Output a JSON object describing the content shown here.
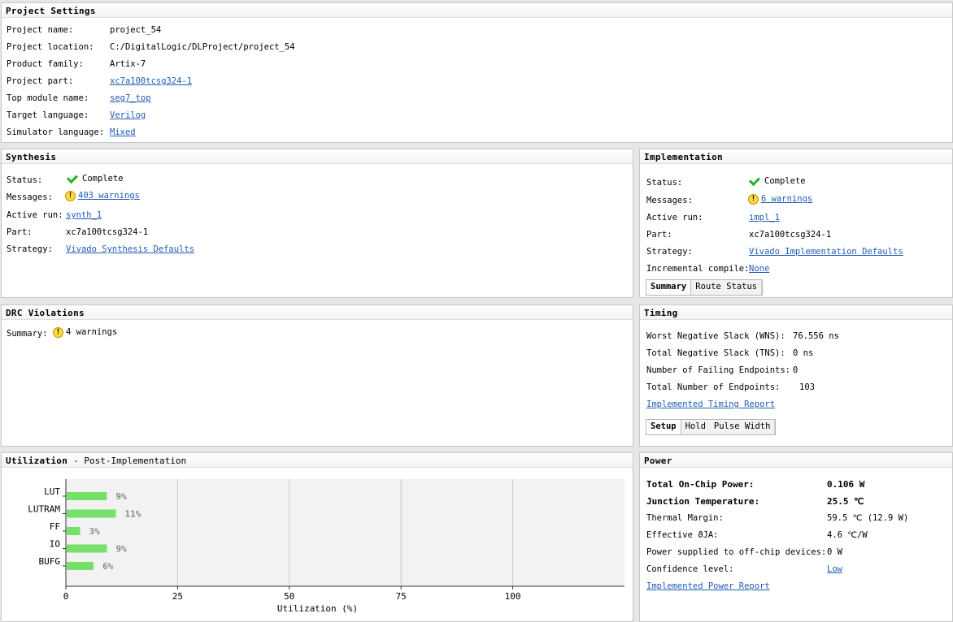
{
  "project_settings": {
    "title": "Project Settings",
    "rows": [
      {
        "label": "Project name:",
        "value": "project_54",
        "link": false
      },
      {
        "label": "Project location:",
        "value": "C:/DigitalLogic/DLProject/project_54",
        "link": false
      },
      {
        "label": "Product family:",
        "value": "Artix-7",
        "link": false
      },
      {
        "label": "Project part:",
        "value": "xc7a100tcsg324-1",
        "link": true
      },
      {
        "label": "Top module name:",
        "value": "seg7_top",
        "link": true
      },
      {
        "label": "Target language:",
        "value": "Verilog",
        "link": true
      },
      {
        "label": "Simulator language:",
        "value": "Mixed",
        "link": true
      }
    ]
  },
  "synthesis": {
    "title": "Synthesis",
    "status_label": "Status:",
    "status_value": "Complete",
    "messages_label": "Messages:",
    "messages_value": "403 warnings",
    "active_run_label": "Active run:",
    "active_run_value": "synth_1",
    "part_label": "Part:",
    "part_value": "xc7a100tcsg324-1",
    "strategy_label": "Strategy:",
    "strategy_value": "Vivado Synthesis Defaults"
  },
  "implementation": {
    "title": "Implementation",
    "status_label": "Status:",
    "status_value": "Complete",
    "messages_label": "Messages:",
    "messages_value": "6 warnings",
    "active_run_label": "Active run:",
    "active_run_value": "impl_1",
    "part_label": "Part:",
    "part_value": "xc7a100tcsg324-1",
    "strategy_label": "Strategy:",
    "strategy_value": "Vivado Implementation Defaults",
    "incremental_label": "Incremental compile:",
    "incremental_value": "None",
    "tabs": [
      "Summary",
      "Route Status"
    ]
  },
  "drc": {
    "title": "DRC Violations",
    "summary_label": "Summary:",
    "summary_value": "4 warnings"
  },
  "timing": {
    "title": "Timing",
    "wns_label": "Worst Negative Slack (WNS):",
    "wns_value": "76.556 ns",
    "tns_label": "Total Negative Slack (TNS):",
    "tns_value": "0 ns",
    "failing_label": "Number of Failing Endpoints:",
    "failing_value": "0",
    "total_label": "Total Number of Endpoints:",
    "total_value": "103",
    "report_link": "Implemented Timing Report",
    "tabs": [
      "Setup",
      "Hold",
      "Pulse Width"
    ]
  },
  "utilization": {
    "title": "Utilization",
    "subtitle": "- Post-Implementation"
  },
  "chart_data": {
    "type": "bar",
    "orientation": "horizontal",
    "categories": [
      "LUT",
      "LUTRAM",
      "FF",
      "IO",
      "BUFG"
    ],
    "values": [
      9,
      11,
      3,
      9,
      6
    ],
    "value_labels": [
      "9%",
      "11%",
      "3%",
      "9%",
      "6%"
    ],
    "xlabel": "Utilization (%)",
    "xlim": [
      0,
      125
    ],
    "xticks": [
      0,
      25,
      50,
      75,
      100
    ],
    "grid": true,
    "bar_color": "#76e06a"
  },
  "power": {
    "title": "Power",
    "total_label": "Total On-Chip Power:",
    "total_value": "0.106 W",
    "junction_label": "Junction Temperature:",
    "junction_value": "25.5 ℃",
    "thermal_label": "Thermal Margin:",
    "thermal_value": "59.5 ℃ (12.9 W)",
    "theta_label": "Effective ϑJA:",
    "theta_value": "4.6 ℃/W",
    "offchip_label": "Power supplied to off-chip devices:",
    "offchip_value": "0 W",
    "confidence_label": "Confidence level:",
    "confidence_value": "Low",
    "report_link": "Implemented Power Report"
  }
}
